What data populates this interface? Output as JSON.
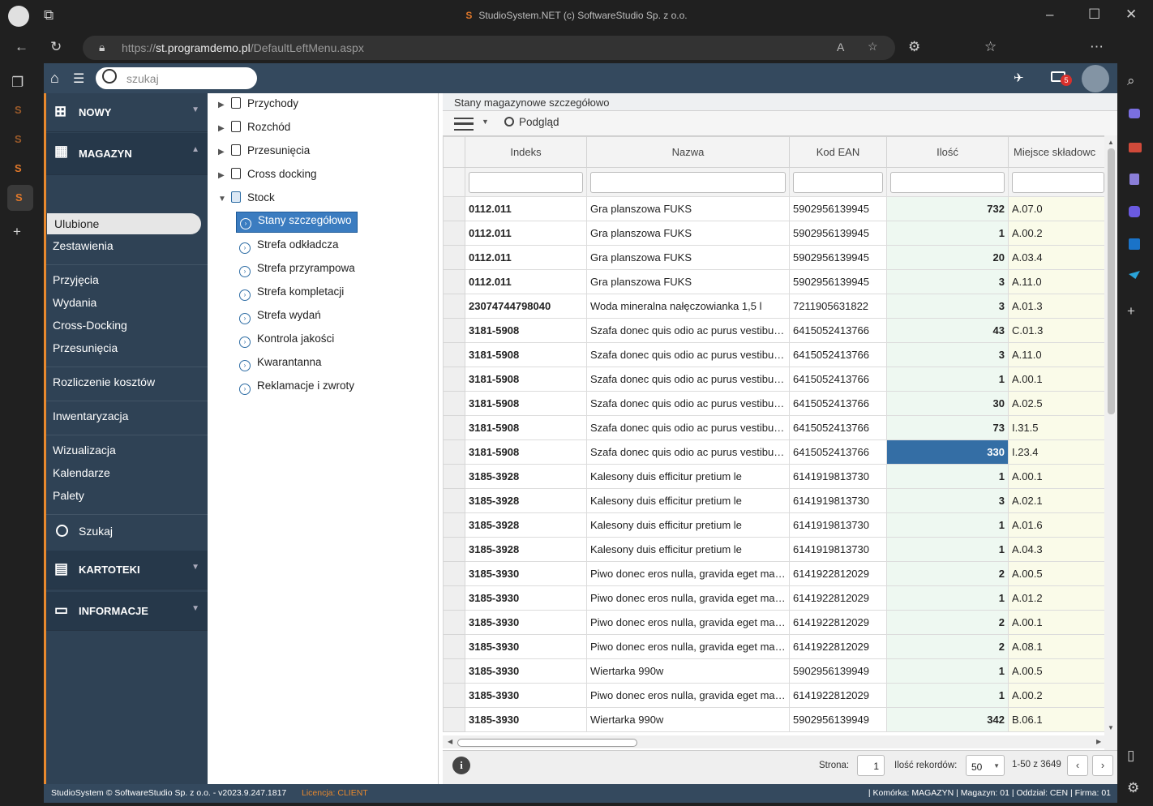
{
  "browser": {
    "title": "StudioSystem.NET (c) SoftwareStudio Sp. z o.o.",
    "url_scheme": "https://",
    "url_host": "st.programdemo.pl",
    "url_path": "/DefaultLeftMenu.aspx"
  },
  "topbar": {
    "search_placeholder": "szukaj",
    "mail_badge": "5"
  },
  "sidebar": {
    "nowy": "NOWY",
    "magazyn": "MAGAZYN",
    "ulubione": "Ulubione",
    "zestawienia": "Zestawienia",
    "group1": [
      "Przyjęcia",
      "Wydania",
      "Cross-Docking",
      "Przesunięcia"
    ],
    "rozliczenie": "Rozliczenie kosztów",
    "inwentaryzacja": "Inwentaryzacja",
    "group2": [
      "Wizualizacja",
      "Kalendarze",
      "Palety"
    ],
    "szukaj": "Szukaj",
    "kartoteki": "KARTOTEKI",
    "informacje": "INFORMACJE"
  },
  "tree": {
    "top": [
      "Przychody",
      "Rozchód",
      "Przesunięcia",
      "Cross docking"
    ],
    "stock": "Stock",
    "children": [
      "Stany szczegółowo",
      "Strefa odkładcza",
      "Strefa przyrampowa",
      "Strefa kompletacji",
      "Strefa wydań",
      "Kontrola jakości",
      "Kwarantanna",
      "Reklamacje i zwroty"
    ]
  },
  "panel": {
    "title": "Stany magazynowe szczegółowo",
    "preview_label": "Podgląd"
  },
  "grid": {
    "columns": [
      "Indeks",
      "Nazwa",
      "Kod EAN",
      "Ilość",
      "Miejsce składowc"
    ],
    "rows": [
      [
        "0112.011",
        "Gra planszowa FUKS",
        "5902956139945",
        "732",
        "A.07.0"
      ],
      [
        "0112.011",
        "Gra planszowa FUKS",
        "5902956139945",
        "1",
        "A.00.2"
      ],
      [
        "0112.011",
        "Gra planszowa FUKS",
        "5902956139945",
        "20",
        "A.03.4"
      ],
      [
        "0112.011",
        "Gra planszowa FUKS",
        "5902956139945",
        "3",
        "A.11.0"
      ],
      [
        "23074744798040",
        "Woda mineralna nałęczowianka 1,5 l",
        "7211905631822",
        "3",
        "A.01.3"
      ],
      [
        "3181-5908",
        "Szafa donec quis odio ac purus vestibulum",
        "6415052413766",
        "43",
        "C.01.3"
      ],
      [
        "3181-5908",
        "Szafa donec quis odio ac purus vestibulum",
        "6415052413766",
        "3",
        "A.11.0"
      ],
      [
        "3181-5908",
        "Szafa donec quis odio ac purus vestibulum",
        "6415052413766",
        "1",
        "A.00.1"
      ],
      [
        "3181-5908",
        "Szafa donec quis odio ac purus vestibulum",
        "6415052413766",
        "30",
        "A.02.5"
      ],
      [
        "3181-5908",
        "Szafa donec quis odio ac purus vestibulum",
        "6415052413766",
        "73",
        "I.31.5"
      ],
      [
        "3181-5908",
        "Szafa donec quis odio ac purus vestibulum",
        "6415052413766",
        "330",
        "I.23.4"
      ],
      [
        "3185-3928",
        "Kalesony duis efficitur pretium le",
        "6141919813730",
        "1",
        "A.00.1"
      ],
      [
        "3185-3928",
        "Kalesony duis efficitur pretium le",
        "6141919813730",
        "3",
        "A.02.1"
      ],
      [
        "3185-3928",
        "Kalesony duis efficitur pretium le",
        "6141919813730",
        "1",
        "A.01.6"
      ],
      [
        "3185-3928",
        "Kalesony duis efficitur pretium le",
        "6141919813730",
        "1",
        "A.04.3"
      ],
      [
        "3185-3930",
        "Piwo donec eros nulla, gravida eget mauris",
        "6141922812029",
        "2",
        "A.00.5"
      ],
      [
        "3185-3930",
        "Piwo donec eros nulla, gravida eget mauris",
        "6141922812029",
        "1",
        "A.01.2"
      ],
      [
        "3185-3930",
        "Piwo donec eros nulla, gravida eget mauris",
        "6141922812029",
        "2",
        "A.00.1"
      ],
      [
        "3185-3930",
        "Piwo donec eros nulla, gravida eget mauris",
        "6141922812029",
        "2",
        "A.08.1"
      ],
      [
        "3185-3930",
        "Wiertarka 990w",
        "5902956139949",
        "1",
        "A.00.5"
      ],
      [
        "3185-3930",
        "Piwo donec eros nulla, gravida eget mauris",
        "6141922812029",
        "1",
        "A.00.2"
      ],
      [
        "3185-3930",
        "Wiertarka 990w",
        "5902956139949",
        "342",
        "B.06.1"
      ]
    ],
    "selected_row": 10
  },
  "footer": {
    "page_label": "Strona:",
    "page_value": "1",
    "records_label": "Ilość rekordów:",
    "records_value": "50",
    "range": "1-50 z 3649"
  },
  "status": {
    "left": "StudioSystem © SoftwareStudio Sp. z o.o. - v2023.9.247.1817",
    "license_label": "Licencja:",
    "license_value": "CLIENT",
    "right": "| Komórka: MAGAZYN | Magazyn: 01 | Oddział: CEN | Firma: 01"
  },
  "colors": {
    "sidebar": "#2f4255",
    "topbar": "#34495e",
    "accent": "#e8892e",
    "selection": "#346ea5"
  }
}
